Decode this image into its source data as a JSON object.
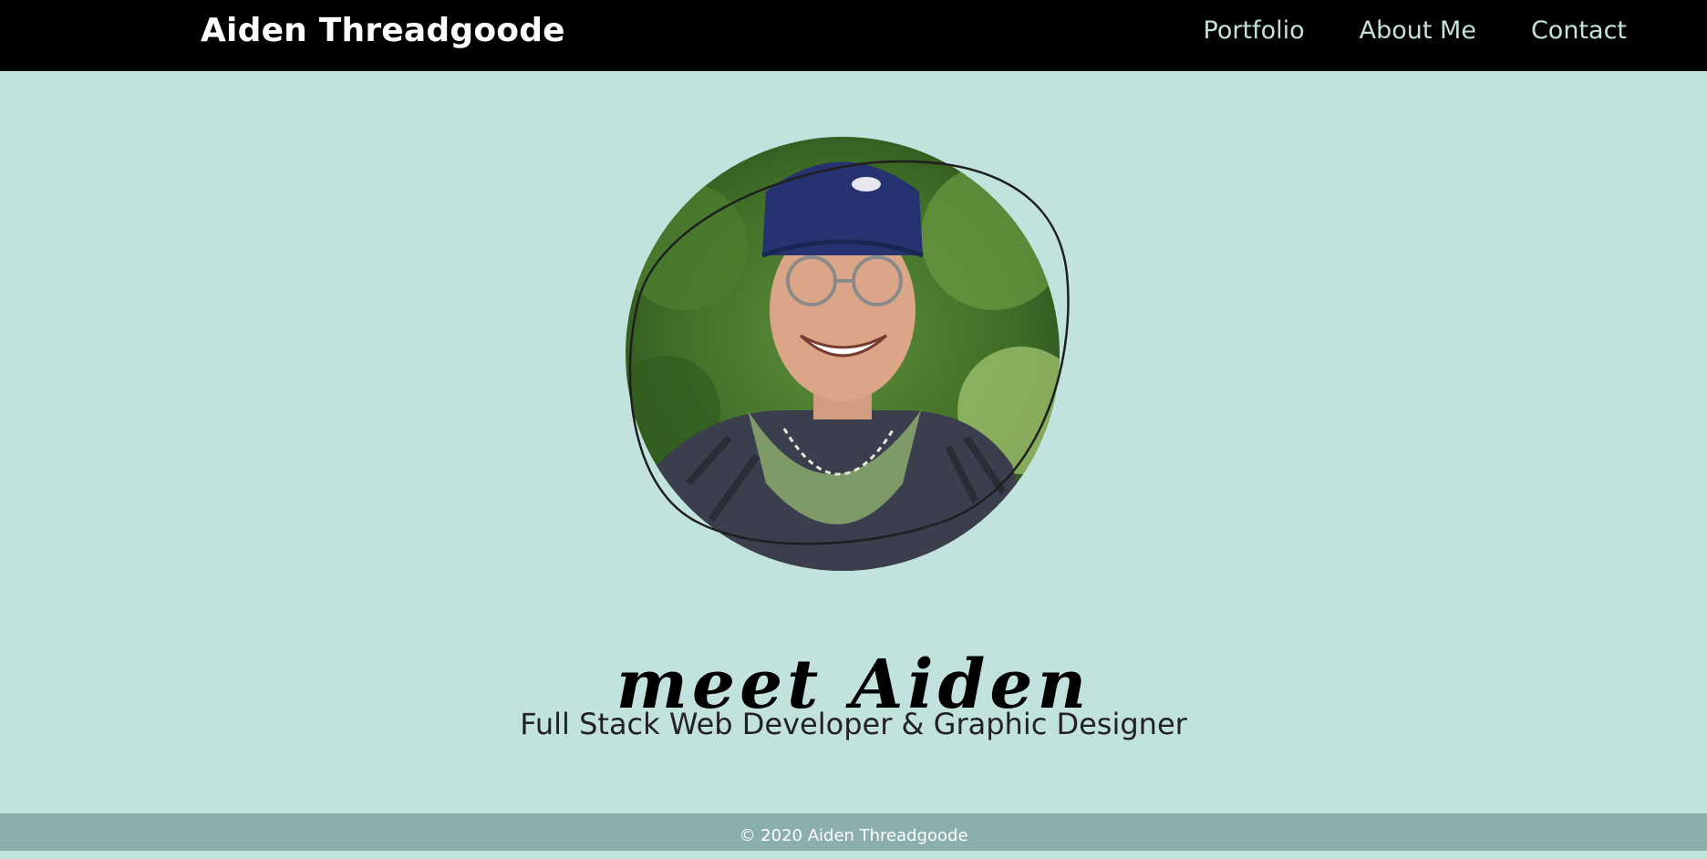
{
  "header": {
    "brand": "Aiden Threadgoode",
    "nav": [
      {
        "label": "Portfolio"
      },
      {
        "label": "About Me"
      },
      {
        "label": "Contact"
      }
    ]
  },
  "hero": {
    "greeting": "meet Aiden",
    "tagline": "Full Stack Web Developer & Graphic Designer"
  },
  "footer": {
    "copyright": "© 2020 Aiden Threadgoode"
  },
  "colors": {
    "navbar": "#000000",
    "background": "#c2e3dd",
    "footer": "#8aafad",
    "nav_link": "#c2e3dd"
  }
}
